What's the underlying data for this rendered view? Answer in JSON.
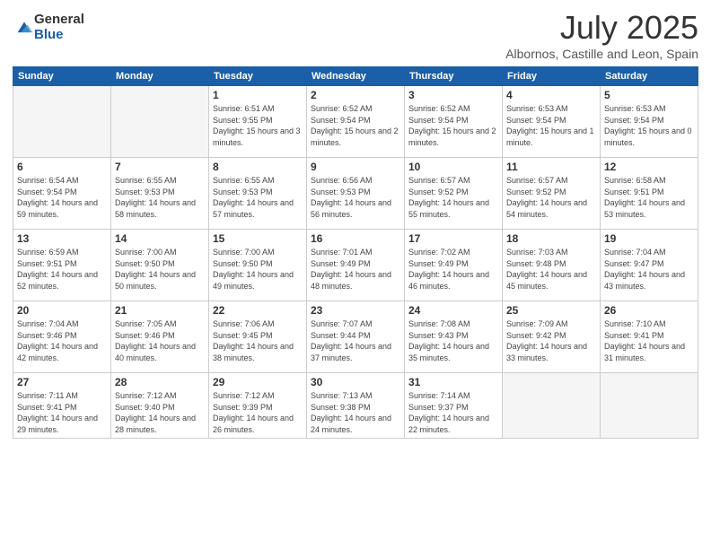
{
  "logo": {
    "general": "General",
    "blue": "Blue"
  },
  "header": {
    "month": "July 2025",
    "location": "Albornos, Castille and Leon, Spain"
  },
  "days_of_week": [
    "Sunday",
    "Monday",
    "Tuesday",
    "Wednesday",
    "Thursday",
    "Friday",
    "Saturday"
  ],
  "weeks": [
    [
      {
        "day": "",
        "empty": true
      },
      {
        "day": "",
        "empty": true
      },
      {
        "day": "1",
        "sunrise": "6:51 AM",
        "sunset": "9:55 PM",
        "daylight": "15 hours and 3 minutes."
      },
      {
        "day": "2",
        "sunrise": "6:52 AM",
        "sunset": "9:54 PM",
        "daylight": "15 hours and 2 minutes."
      },
      {
        "day": "3",
        "sunrise": "6:52 AM",
        "sunset": "9:54 PM",
        "daylight": "15 hours and 2 minutes."
      },
      {
        "day": "4",
        "sunrise": "6:53 AM",
        "sunset": "9:54 PM",
        "daylight": "15 hours and 1 minute."
      },
      {
        "day": "5",
        "sunrise": "6:53 AM",
        "sunset": "9:54 PM",
        "daylight": "15 hours and 0 minutes."
      }
    ],
    [
      {
        "day": "6",
        "sunrise": "6:54 AM",
        "sunset": "9:54 PM",
        "daylight": "14 hours and 59 minutes."
      },
      {
        "day": "7",
        "sunrise": "6:55 AM",
        "sunset": "9:53 PM",
        "daylight": "14 hours and 58 minutes."
      },
      {
        "day": "8",
        "sunrise": "6:55 AM",
        "sunset": "9:53 PM",
        "daylight": "14 hours and 57 minutes."
      },
      {
        "day": "9",
        "sunrise": "6:56 AM",
        "sunset": "9:53 PM",
        "daylight": "14 hours and 56 minutes."
      },
      {
        "day": "10",
        "sunrise": "6:57 AM",
        "sunset": "9:52 PM",
        "daylight": "14 hours and 55 minutes."
      },
      {
        "day": "11",
        "sunrise": "6:57 AM",
        "sunset": "9:52 PM",
        "daylight": "14 hours and 54 minutes."
      },
      {
        "day": "12",
        "sunrise": "6:58 AM",
        "sunset": "9:51 PM",
        "daylight": "14 hours and 53 minutes."
      }
    ],
    [
      {
        "day": "13",
        "sunrise": "6:59 AM",
        "sunset": "9:51 PM",
        "daylight": "14 hours and 52 minutes."
      },
      {
        "day": "14",
        "sunrise": "7:00 AM",
        "sunset": "9:50 PM",
        "daylight": "14 hours and 50 minutes."
      },
      {
        "day": "15",
        "sunrise": "7:00 AM",
        "sunset": "9:50 PM",
        "daylight": "14 hours and 49 minutes."
      },
      {
        "day": "16",
        "sunrise": "7:01 AM",
        "sunset": "9:49 PM",
        "daylight": "14 hours and 48 minutes."
      },
      {
        "day": "17",
        "sunrise": "7:02 AM",
        "sunset": "9:49 PM",
        "daylight": "14 hours and 46 minutes."
      },
      {
        "day": "18",
        "sunrise": "7:03 AM",
        "sunset": "9:48 PM",
        "daylight": "14 hours and 45 minutes."
      },
      {
        "day": "19",
        "sunrise": "7:04 AM",
        "sunset": "9:47 PM",
        "daylight": "14 hours and 43 minutes."
      }
    ],
    [
      {
        "day": "20",
        "sunrise": "7:04 AM",
        "sunset": "9:46 PM",
        "daylight": "14 hours and 42 minutes."
      },
      {
        "day": "21",
        "sunrise": "7:05 AM",
        "sunset": "9:46 PM",
        "daylight": "14 hours and 40 minutes."
      },
      {
        "day": "22",
        "sunrise": "7:06 AM",
        "sunset": "9:45 PM",
        "daylight": "14 hours and 38 minutes."
      },
      {
        "day": "23",
        "sunrise": "7:07 AM",
        "sunset": "9:44 PM",
        "daylight": "14 hours and 37 minutes."
      },
      {
        "day": "24",
        "sunrise": "7:08 AM",
        "sunset": "9:43 PM",
        "daylight": "14 hours and 35 minutes."
      },
      {
        "day": "25",
        "sunrise": "7:09 AM",
        "sunset": "9:42 PM",
        "daylight": "14 hours and 33 minutes."
      },
      {
        "day": "26",
        "sunrise": "7:10 AM",
        "sunset": "9:41 PM",
        "daylight": "14 hours and 31 minutes."
      }
    ],
    [
      {
        "day": "27",
        "sunrise": "7:11 AM",
        "sunset": "9:41 PM",
        "daylight": "14 hours and 29 minutes."
      },
      {
        "day": "28",
        "sunrise": "7:12 AM",
        "sunset": "9:40 PM",
        "daylight": "14 hours and 28 minutes."
      },
      {
        "day": "29",
        "sunrise": "7:12 AM",
        "sunset": "9:39 PM",
        "daylight": "14 hours and 26 minutes."
      },
      {
        "day": "30",
        "sunrise": "7:13 AM",
        "sunset": "9:38 PM",
        "daylight": "14 hours and 24 minutes."
      },
      {
        "day": "31",
        "sunrise": "7:14 AM",
        "sunset": "9:37 PM",
        "daylight": "14 hours and 22 minutes."
      },
      {
        "day": "",
        "empty": true
      },
      {
        "day": "",
        "empty": true
      }
    ]
  ]
}
